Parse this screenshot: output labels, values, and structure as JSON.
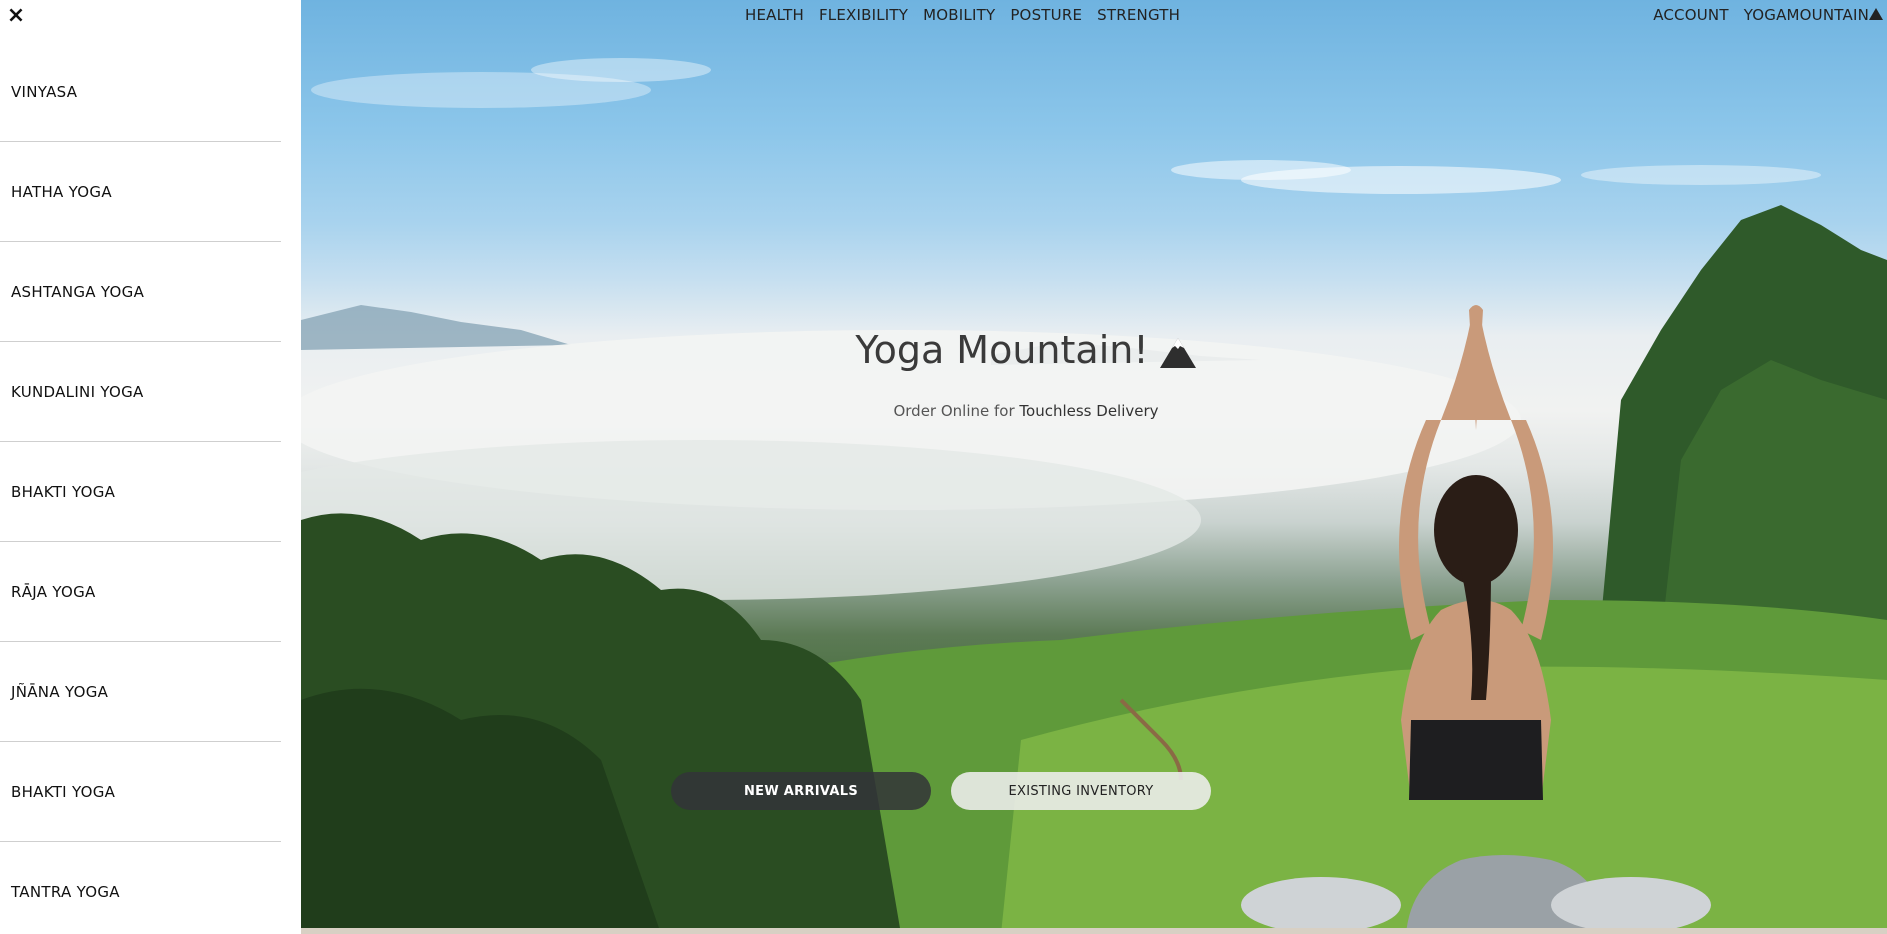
{
  "sidebar": {
    "close_label": "×",
    "items": [
      {
        "label": "VINYASA"
      },
      {
        "label": "HATHA YOGA"
      },
      {
        "label": "ASHTANGA YOGA"
      },
      {
        "label": "KUNDALINI YOGA"
      },
      {
        "label": "BHAKTI YOGA"
      },
      {
        "label": "RĀJA YOGA"
      },
      {
        "label": "JÑĀNA YOGA"
      },
      {
        "label": "BHAKTI YOGA"
      },
      {
        "label": "TANTRA YOGA"
      }
    ]
  },
  "topnav": {
    "items": [
      {
        "label": "HEALTH"
      },
      {
        "label": "FLEXIBILITY"
      },
      {
        "label": "MOBILITY"
      },
      {
        "label": "POSTURE"
      },
      {
        "label": "STRENGTH"
      }
    ]
  },
  "rightnav": {
    "account": "ACCOUNT",
    "brand": "YOGAMOUNTAIN"
  },
  "hero": {
    "title": "Yoga Mountain!",
    "subtitle_prefix": "Order Online for ",
    "subtitle_highlight": "Touchless Delivery",
    "primary_button": "NEW ARRIVALS",
    "secondary_button": "EXISTING INVENTORY"
  },
  "icons": {
    "close": "close-icon",
    "mountain": "mountain-icon"
  },
  "colors": {
    "sky": "#6fb3e0",
    "button_dark": "#323438",
    "button_light": "#ebecea"
  }
}
